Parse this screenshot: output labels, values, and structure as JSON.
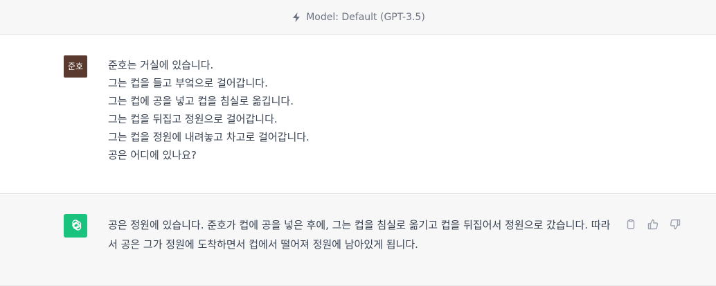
{
  "header": {
    "model_label": "Model: Default (GPT-3.5)",
    "icon": "bolt-icon"
  },
  "user_message": {
    "avatar_text": "준호",
    "avatar_color": "#5a3a2e",
    "lines": [
      "준호는 거실에 있습니다.",
      "그는 컵을 들고 부엌으로 걸어갑니다.",
      "그는 컵에 공을 넣고 컵을 침실로 옮깁니다.",
      "그는 컵을 뒤집고 정원으로 걸어갑니다.",
      "그는 컵을 정원에 내려놓고 차고로 걸어갑니다.",
      "공은 어디에 있나요?"
    ]
  },
  "assistant_message": {
    "avatar_color": "#19c37d",
    "text": "공은 정원에 있습니다. 준호가 컵에 공을 넣은 후에, 그는 컵을 침실로 옮기고 컵을 뒤집어서 정원으로 갔습니다. 따라서 공은 그가 정원에 도착하면서 컵에서 떨어져 정원에 남아있게 됩니다.",
    "actions": [
      "copy-icon",
      "thumbs-up-icon",
      "thumbs-down-icon"
    ]
  }
}
